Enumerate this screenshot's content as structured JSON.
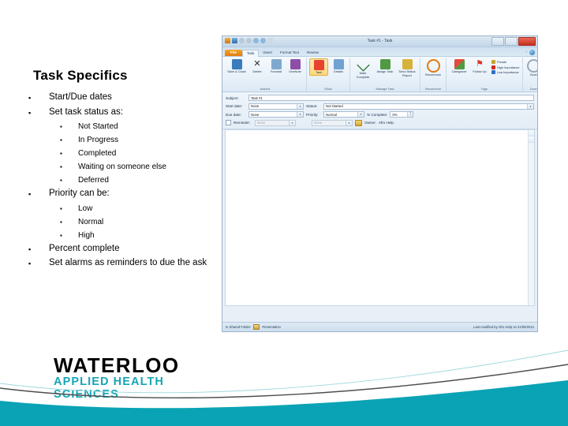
{
  "slide": {
    "title": "Task Specifics",
    "bullets": [
      {
        "level": 1,
        "text": "Start/Due dates"
      },
      {
        "level": 1,
        "text": "Set task status as:"
      },
      {
        "level": 2,
        "text": "Not Started"
      },
      {
        "level": 2,
        "text": "In Progress"
      },
      {
        "level": 2,
        "text": "Completed"
      },
      {
        "level": 2,
        "text": "Waiting on someone else"
      },
      {
        "level": 2,
        "text": "Deferred"
      },
      {
        "level": 1,
        "text": "Priority can be:"
      },
      {
        "level": 2,
        "text": "Low"
      },
      {
        "level": 2,
        "text": "Normal"
      },
      {
        "level": 2,
        "text": "High"
      },
      {
        "level": 1,
        "text": "Percent complete"
      },
      {
        "level": 1,
        "text": "Set alarms as reminders to due the ask"
      }
    ],
    "bullet_marker": "▪"
  },
  "logo": {
    "main": "WATERLOO",
    "line2": "APPLIED HEALTH",
    "line3": "SCIENCES",
    "main_color": "#000000",
    "sub_color": "#16a5b5"
  },
  "decor": {
    "band_color": "#0aa3b5",
    "line_dark": "#4d4d4d",
    "line_light": "#9fd8df"
  },
  "outlook": {
    "window_title": "Task #1 - Task",
    "quick_access": [
      "save-icon",
      "undo-icon",
      "redo-icon",
      "previous-icon",
      "next-icon",
      "customize-icon"
    ],
    "window_controls": [
      "minimize-button",
      "maximize-button",
      "close-button"
    ],
    "tabs": [
      {
        "label": "File",
        "state": "file"
      },
      {
        "label": "Task",
        "state": "active"
      },
      {
        "label": "Insert",
        "state": "normal"
      },
      {
        "label": "Format Text",
        "state": "normal"
      },
      {
        "label": "Review",
        "state": "normal"
      }
    ],
    "ribbon_groups": [
      {
        "name": "Actions",
        "items": [
          {
            "label": "Save & Close",
            "icon": "save-close-icon",
            "color": "#3a7bbf",
            "selected": false
          },
          {
            "label": "Delete",
            "icon": "delete-x-icon",
            "color": "#2b2b2b",
            "selected": false
          },
          {
            "label": "Forward",
            "icon": "forward-icon",
            "color": "#7fa8cf",
            "selected": false
          },
          {
            "label": "OneNote",
            "icon": "onenote-icon",
            "color": "#8e4ea8",
            "selected": false
          }
        ]
      },
      {
        "name": "Show",
        "items": [
          {
            "label": "Task",
            "icon": "task-checklist-icon",
            "color": "#e8432f",
            "selected": true
          },
          {
            "label": "Details",
            "icon": "details-icon",
            "color": "#6fa3d2",
            "selected": false
          }
        ]
      },
      {
        "name": "Manage Task",
        "items": [
          {
            "label": "Mark Complete",
            "icon": "check-mark-icon",
            "color": "#2f7d32",
            "selected": false
          },
          {
            "label": "Assign Task",
            "icon": "assign-task-icon",
            "color": "#4f9a43",
            "selected": false
          },
          {
            "label": "Send Status Report",
            "icon": "send-status-report-icon",
            "color": "#d7b23a",
            "selected": false
          }
        ]
      },
      {
        "name": "Recurrence",
        "items": [
          {
            "label": "Recurrence",
            "icon": "recurrence-icon",
            "color": "#e07b10",
            "selected": false
          }
        ]
      },
      {
        "name": "Tags",
        "items": [
          {
            "label": "Categorize",
            "icon": "categorize-icon",
            "color": "#d84b3a",
            "selected": false
          },
          {
            "label": "Follow Up",
            "icon": "follow-up-flag-icon",
            "color": "#d43b2a",
            "selected": false
          }
        ],
        "stack": [
          {
            "label": "Private",
            "icon": "lock-icon",
            "color": "#c8a233"
          },
          {
            "label": "High Importance",
            "icon": "high-importance-icon",
            "color": "#cc2b1e"
          },
          {
            "label": "Low Importance",
            "icon": "low-importance-icon",
            "color": "#2f6ec4"
          }
        ]
      },
      {
        "name": "Zoom",
        "items": [
          {
            "label": "Zoom",
            "icon": "zoom-magnifier-icon",
            "color": "#9aa8b6",
            "selected": false
          }
        ]
      }
    ],
    "form": {
      "subject_label": "Subject:",
      "subject_value": "Task #1",
      "start_date_label": "Start date:",
      "start_date_value": "None",
      "due_date_label": "Due date:",
      "due_date_value": "None",
      "status_label": "Status:",
      "status_value": "Not Started",
      "priority_label": "Priority:",
      "priority_value": "Normal",
      "percent_label": "% Complete:",
      "percent_value": "0%",
      "reminder_label": "Reminder:",
      "reminder_date_value": "None",
      "reminder_time_value": "None",
      "owner_label": "Owner:",
      "owner_value": "Afro Help"
    },
    "notes_body": "",
    "status_bar": {
      "folder_label": "In Shared Folder:",
      "folder_name": "Presentation",
      "last_modified": "Last modified by Afro Help on 21/09/2012"
    }
  }
}
